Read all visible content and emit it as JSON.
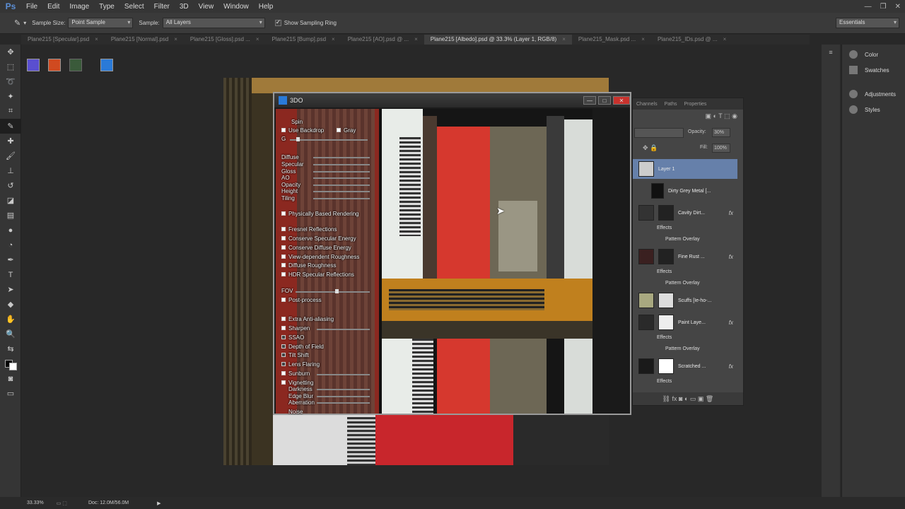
{
  "app": {
    "logo": "Ps"
  },
  "menu": [
    "File",
    "Edit",
    "Image",
    "Type",
    "Select",
    "Filter",
    "3D",
    "View",
    "Window",
    "Help"
  ],
  "options": {
    "sample_size_label": "Sample Size:",
    "sample_size_value": "Point Sample",
    "sample_label": "Sample:",
    "sample_value": "All Layers",
    "show_ring_label": "Show Sampling Ring",
    "workspace": "Essentials"
  },
  "tabs": [
    "Plane215 [Specular].psd",
    "Plane215 [Normal].psd",
    "Plane215 [Gloss].psd ...",
    "Plane215 [Bump].psd",
    "Plane215 [AO].psd @ ...",
    "Plane215 [Albedo].psd @ 33.3% (Layer 1, RGB/8)",
    "Plane215_Mask.psd ...",
    "Plane215_IDs.psd @ ..."
  ],
  "win3do": {
    "title": "3DO",
    "controls": {
      "spin": "Spin",
      "use_backdrop": "Use Backdrop",
      "gray": "Gray",
      "g": "G",
      "diffuse": "Diffuse",
      "specular": "Specular",
      "gloss": "Gloss",
      "ao": "AO",
      "opacity": "Opacity",
      "height": "Height",
      "tiling": "Tiling",
      "pbr": "Physically Based Rendering",
      "fresnel": "Fresnel Reflections",
      "conserve_spec": "Conserve Specular Energy",
      "conserve_diff": "Conserve Diffuse Energy",
      "view_rough": "View-dependent Roughness",
      "diff_rough": "Diffuse Roughness",
      "hdr_spec": "HDR Specular Reflections",
      "fov": "FOV",
      "post": "Post-process",
      "extra_aa": "Extra Anti-aliasing",
      "sharpen": "Sharpen",
      "ssao": "SSAO",
      "dof": "Depth of Field",
      "tilt": "Tilt Shift",
      "lens": "Lens Flaring",
      "sunburn": "Sunburn",
      "vignetting": "Vignetting",
      "darkness": "Darkness",
      "edge_blur": "Edge Blur",
      "aberration": "Aberration",
      "noise": "Noise"
    }
  },
  "right_panel": {
    "items": [
      "Color",
      "Swatches",
      "Adjustments",
      "Styles"
    ]
  },
  "layers_panel": {
    "tabs": [
      "Channels",
      "Paths",
      "Properties"
    ],
    "opacity_label": "Opacity:",
    "opacity_value": "30%",
    "fill_label": "Fill:",
    "fill_value": "100%",
    "layers": [
      {
        "name": "Layer 1"
      },
      {
        "name": "Dirty Grey Metal [..."
      },
      {
        "name": "Cavity Dirt..."
      },
      {
        "name": "Fine Rust ..."
      },
      {
        "name": "Scuffs [Ie-ho-..."
      },
      {
        "name": "Paint Laye..."
      },
      {
        "name": "Scratched ..."
      }
    ],
    "effects_label": "Effects",
    "pattern_overlay": "Pattern Overlay"
  },
  "status": {
    "zoom": "33.33%",
    "doc": "Doc: 12.0M/56.0M"
  }
}
